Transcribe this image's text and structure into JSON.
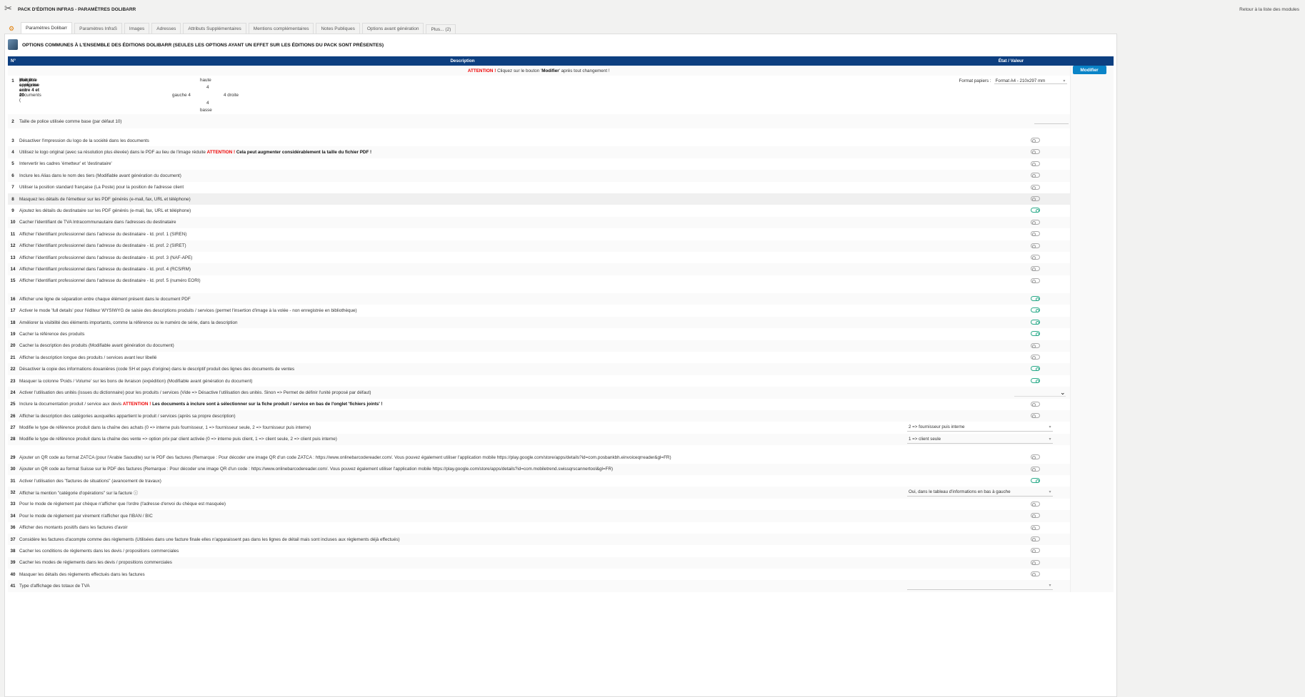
{
  "header": {
    "title": "PACK D'ÉDITION INFRAS - PARAMÈTRES DOLIBARR",
    "back_link": "Retour à la liste des modules"
  },
  "tabs": [
    "Paramètres Dolibarr",
    "Paramètres InfraS",
    "Images",
    "Adresses",
    "Attributs Supplémentaires",
    "Mentions complémentaires",
    "Notes Publiques",
    "Options avant génération",
    "Plus... (2)"
  ],
  "section_title": "OPTIONS COMMUNES À L'ENSEMBLE DES ÉDITIONS DOLIBARR (SEULES LES OPTIONS AYANT UN EFFET SUR LES ÉDITIONS DU PACK SONT PRÉSENTES)",
  "table": {
    "col_num": "N°",
    "col_desc": "Description",
    "col_val": "État / Valeur"
  },
  "attention": {
    "warn": "ATTENTION !",
    "pre": " Cliquez sur le bouton '",
    "bold": "Modifier",
    "post": "' après tout changement !"
  },
  "modifier_label": "Modifier",
  "row1": {
    "num": "1",
    "text": "Marge à appliquer aux documents (",
    "bold": "doit être comprise entre 4 et 20",
    "post": ") :",
    "haute": "haute",
    "top": "4",
    "gauche": "gauche 4",
    "droite": "4 droite",
    "bottom": "4",
    "basse": "basse",
    "format_label": "Format papiers :",
    "format_value": "Format A4 - 210x297 mm"
  },
  "rows": [
    {
      "num": "2",
      "text": "Taille de police utilisée comme base (par défaut 10)",
      "ctrl": "input"
    },
    {
      "spacer": true
    },
    {
      "num": "3",
      "text": "Désactiver l'impression du logo de la société dans les documents",
      "ctrl": "toggle",
      "on": false
    },
    {
      "num": "4",
      "text": "Utilisez le logo original (avec sa résolution plus élevée) dans le PDF au lieu de l'image réduite ",
      "warn": "ATTENTION !",
      "bold": " Cela peut augmenter considérablement la taille du fichier PDF !",
      "ctrl": "toggle",
      "on": false
    },
    {
      "num": "5",
      "text": "Intervertir les cadres 'émetteur' et 'destinataire'",
      "ctrl": "toggle",
      "on": false
    },
    {
      "num": "6",
      "text": "Inclure les Alias dans le nom des tiers (Modifiable avant génération du document)",
      "ctrl": "toggle",
      "on": false
    },
    {
      "num": "7",
      "text": "Utiliser la position standard française (La Poste) pour la position de l'adresse client",
      "ctrl": "toggle",
      "on": false
    },
    {
      "num": "8",
      "text": "Masquez les détails de l'émetteur sur les PDF générés (e-mail, fax, URL et téléphone)",
      "ctrl": "toggle",
      "on": false,
      "hl": true
    },
    {
      "num": "9",
      "text": "Ajoutez les détails du destinataire sur les PDF générés (e-mail, fax, URL et téléphone)",
      "ctrl": "toggle",
      "on": true
    },
    {
      "num": "10",
      "text": "Cacher l'identifiant de TVA Intracommunautaire dans l'adresses du destinataire",
      "ctrl": "toggle",
      "on": false
    },
    {
      "num": "11",
      "text": "Afficher l'identifiant professionnel dans l'adresse du destinataire - Id. prof. 1 (SIREN)",
      "ctrl": "toggle",
      "on": false
    },
    {
      "num": "12",
      "text": "Afficher l'identifiant professionnel dans l'adresse du destinataire - Id. prof. 2 (SIRET)",
      "ctrl": "toggle",
      "on": false
    },
    {
      "num": "13",
      "text": "Afficher l'identifiant professionnel dans l'adresse du destinataire - Id. prof. 3 (NAF-APE)",
      "ctrl": "toggle",
      "on": false
    },
    {
      "num": "14",
      "text": "Afficher l'identifiant professionnel dans l'adresse du destinataire - Id. prof. 4 (RCS/RM)",
      "ctrl": "toggle",
      "on": false
    },
    {
      "num": "15",
      "text": "Afficher l'identifiant professionnel dans l'adresse du destinataire - Id. prof. 5 (numéro EORI)",
      "ctrl": "toggle",
      "on": false
    },
    {
      "spacer": true
    },
    {
      "num": "16",
      "text": "Afficher une ligne de séparation entre chaque élément présent dans le document PDF",
      "ctrl": "toggle",
      "on": true
    },
    {
      "num": "17",
      "text": "Activer le mode 'full details' pour l'éditeur WYSIWYG de saisie des descriptions produits / services (permet l'insertion d'image à la volée - non enregistrée en bibliothèque)",
      "ctrl": "toggle",
      "on": true
    },
    {
      "num": "18",
      "text": "Améliorer la visibilité des éléments importants, comme la référence ou le numéro de série, dans la description",
      "ctrl": "toggle",
      "on": true
    },
    {
      "num": "19",
      "text": "Cacher la référence des produits",
      "ctrl": "toggle",
      "on": true
    },
    {
      "num": "20",
      "text": "Cacher la description des produits (Modifiable avant génération du document)",
      "ctrl": "toggle",
      "on": false
    },
    {
      "num": "21",
      "text": "Afficher la description longue des produits / services avant leur libellé",
      "ctrl": "toggle",
      "on": false
    },
    {
      "num": "22",
      "text": "Désactiver la copie des informations douanières (code SH et pays d'origine) dans le descriptif produit des lignes des documents de ventes",
      "ctrl": "toggle",
      "on": true
    },
    {
      "num": "23",
      "text": "Masquer la colonne 'Poids / Volume' sur les bons de livraison (expédition) (Modifiable avant génération du document)",
      "ctrl": "toggle",
      "on": true
    },
    {
      "num": "24",
      "text": "Activer l'utilisation des unités (issues du dictionnaire) pour les produits / services (Vide => Désactive l'utilisation des unités. Sinon => Permet de définir l'unité proposé par défaut)",
      "ctrl": "chevron"
    },
    {
      "num": "25",
      "text": "Inclure la documentation produit / service aux devis ",
      "warn": "ATTENTION !",
      "bold": " Les documents à inclure sont à sélectionner sur la fiche produit / service en bas de l'onglet 'fichiers joints' !",
      "ctrl": "toggle",
      "on": false
    },
    {
      "num": "26",
      "text": "Afficher la description des catégories auxquelles appartient le produit / services (après sa propre description)",
      "ctrl": "toggle",
      "on": false
    },
    {
      "num": "27",
      "text": "Modifie le type de référence produit dans la chaîne des achats (0 => interne puis fournisseur, 1 => fournisseur seule, 2 => fournisseur puis interne)",
      "ctrl": "select",
      "value": "2 => fournisseur puis interne"
    },
    {
      "num": "28",
      "text": "Modifie le type de référence produit dans la chaîne des vente => option prix par client activée (0 => interne puis client, 1 => client seule, 2 => client puis interne)",
      "ctrl": "select",
      "value": "1 => client seule"
    },
    {
      "spacer": true
    },
    {
      "num": "29",
      "text": "Ajouter un QR code au format ZATCA (pour l'Arabie Saoudite) sur le PDF des factures (Remarque : Pour décoder une image QR d'un code ZATCA : https://www.onlinebarcodereader.com/. Vous pouvez également utiliser l'application mobile https://play.google.com/store/apps/details?id=com.posbankbh.einvoiceqrreader&gl=FR)",
      "ctrl": "toggle",
      "on": false
    },
    {
      "num": "30",
      "text": "Ajouter un QR code au format Suisse sur le PDF des factures (Remarque : Pour décoder une image QR d'un code : https://www.onlinebarcodereader.com/. Vous pouvez également utiliser l'application mobile https://play.google.com/store/apps/details?id=com.mobiletrend.swissqrscannertool&gl=FR)",
      "ctrl": "toggle",
      "on": false
    },
    {
      "num": "31",
      "text": "Activer l'utilisation des \"factures de situations\" (avancement de travaux)",
      "ctrl": "toggle",
      "on": true
    },
    {
      "num": "32",
      "text": "Afficher la mention \"catégorie d'opérations\" sur la facture ⓘ",
      "ctrl": "select",
      "value": "Oui, dans le tableau d'informations en bas à gauche"
    },
    {
      "num": "33",
      "text": "Pour le mode de règlement par chèque n'afficher que l'ordre (l'adresse d'envoi du chèque est masquée)",
      "ctrl": "toggle",
      "on": false
    },
    {
      "num": "34",
      "text": "Pour le mode de règlement par virement n'afficher que l'IBAN / BIC",
      "ctrl": "toggle",
      "on": false
    },
    {
      "num": "36",
      "text": "Afficher des montants positifs dans les factures d'avoir",
      "ctrl": "toggle",
      "on": false
    },
    {
      "num": "37",
      "text": "Considère les factures d'acompte comme des règlements (Utilisées dans une facture finale elles n'apparaissent pas dans les lignes de détail mais sont incluses aux règlements déjà effectués)",
      "ctrl": "toggle",
      "on": false
    },
    {
      "num": "38",
      "text": "Cacher les conditions de règlements dans les devis / propositions commerciales",
      "ctrl": "toggle",
      "on": false
    },
    {
      "num": "39",
      "text": "Cacher les modes de règlements dans les devis / propositions commerciales",
      "ctrl": "toggle",
      "on": false
    },
    {
      "num": "40",
      "text": "Masquer les détails des règlements effectués dans les factures",
      "ctrl": "toggle",
      "on": false
    },
    {
      "num": "41",
      "text": "Type d'affichage des totaux de TVA",
      "ctrl": "select",
      "value": ""
    }
  ]
}
